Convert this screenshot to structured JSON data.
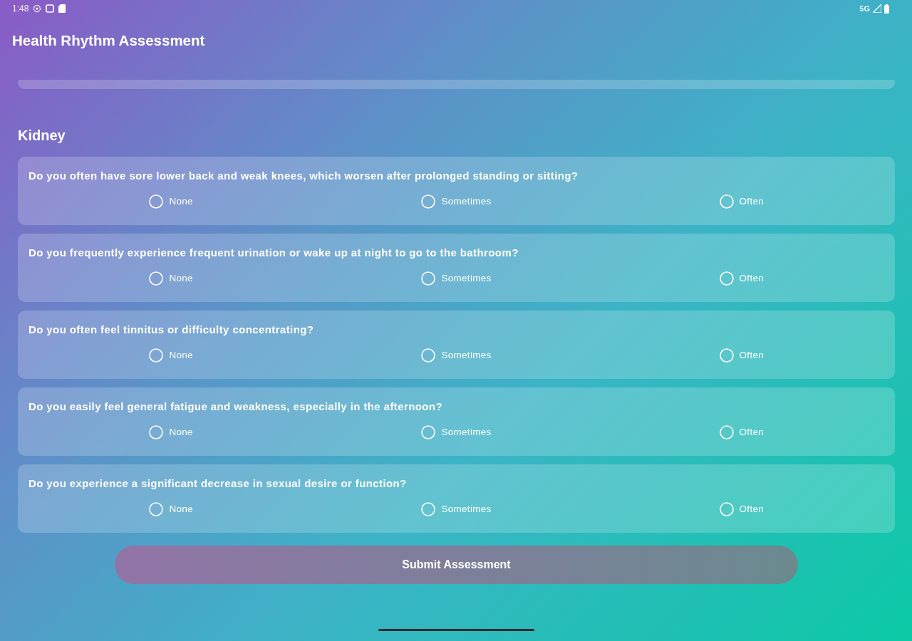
{
  "status_bar": {
    "time": "1:48",
    "network": "5G"
  },
  "app_bar": {
    "title": "Health Rhythm Assessment"
  },
  "section": {
    "title": "Kidney",
    "questions": [
      {
        "text": "Do you often have sore lower back and weak knees, which worsen after prolonged standing or sitting?",
        "options": [
          {
            "label": "None",
            "selected": false
          },
          {
            "label": "Sometimes",
            "selected": false
          },
          {
            "label": "Often",
            "selected": false
          }
        ]
      },
      {
        "text": "Do you frequently experience frequent urination or wake up at night to go to the bathroom?",
        "options": [
          {
            "label": "None",
            "selected": false
          },
          {
            "label": "Sometimes",
            "selected": false
          },
          {
            "label": "Often",
            "selected": false
          }
        ]
      },
      {
        "text": "Do you often feel tinnitus or difficulty concentrating?",
        "options": [
          {
            "label": "None",
            "selected": false
          },
          {
            "label": "Sometimes",
            "selected": false
          },
          {
            "label": "Often",
            "selected": false
          }
        ]
      },
      {
        "text": "Do you easily feel general fatigue and weakness, especially in the afternoon?",
        "options": [
          {
            "label": "None",
            "selected": false
          },
          {
            "label": "Sometimes",
            "selected": false
          },
          {
            "label": "Often",
            "selected": false
          }
        ]
      },
      {
        "text": "Do you experience a significant decrease in sexual desire or function?",
        "options": [
          {
            "label": "None",
            "selected": false
          },
          {
            "label": "Sometimes",
            "selected": false
          },
          {
            "label": "Often",
            "selected": false
          }
        ]
      }
    ]
  },
  "submit_button": {
    "label": "Submit Assessment"
  }
}
